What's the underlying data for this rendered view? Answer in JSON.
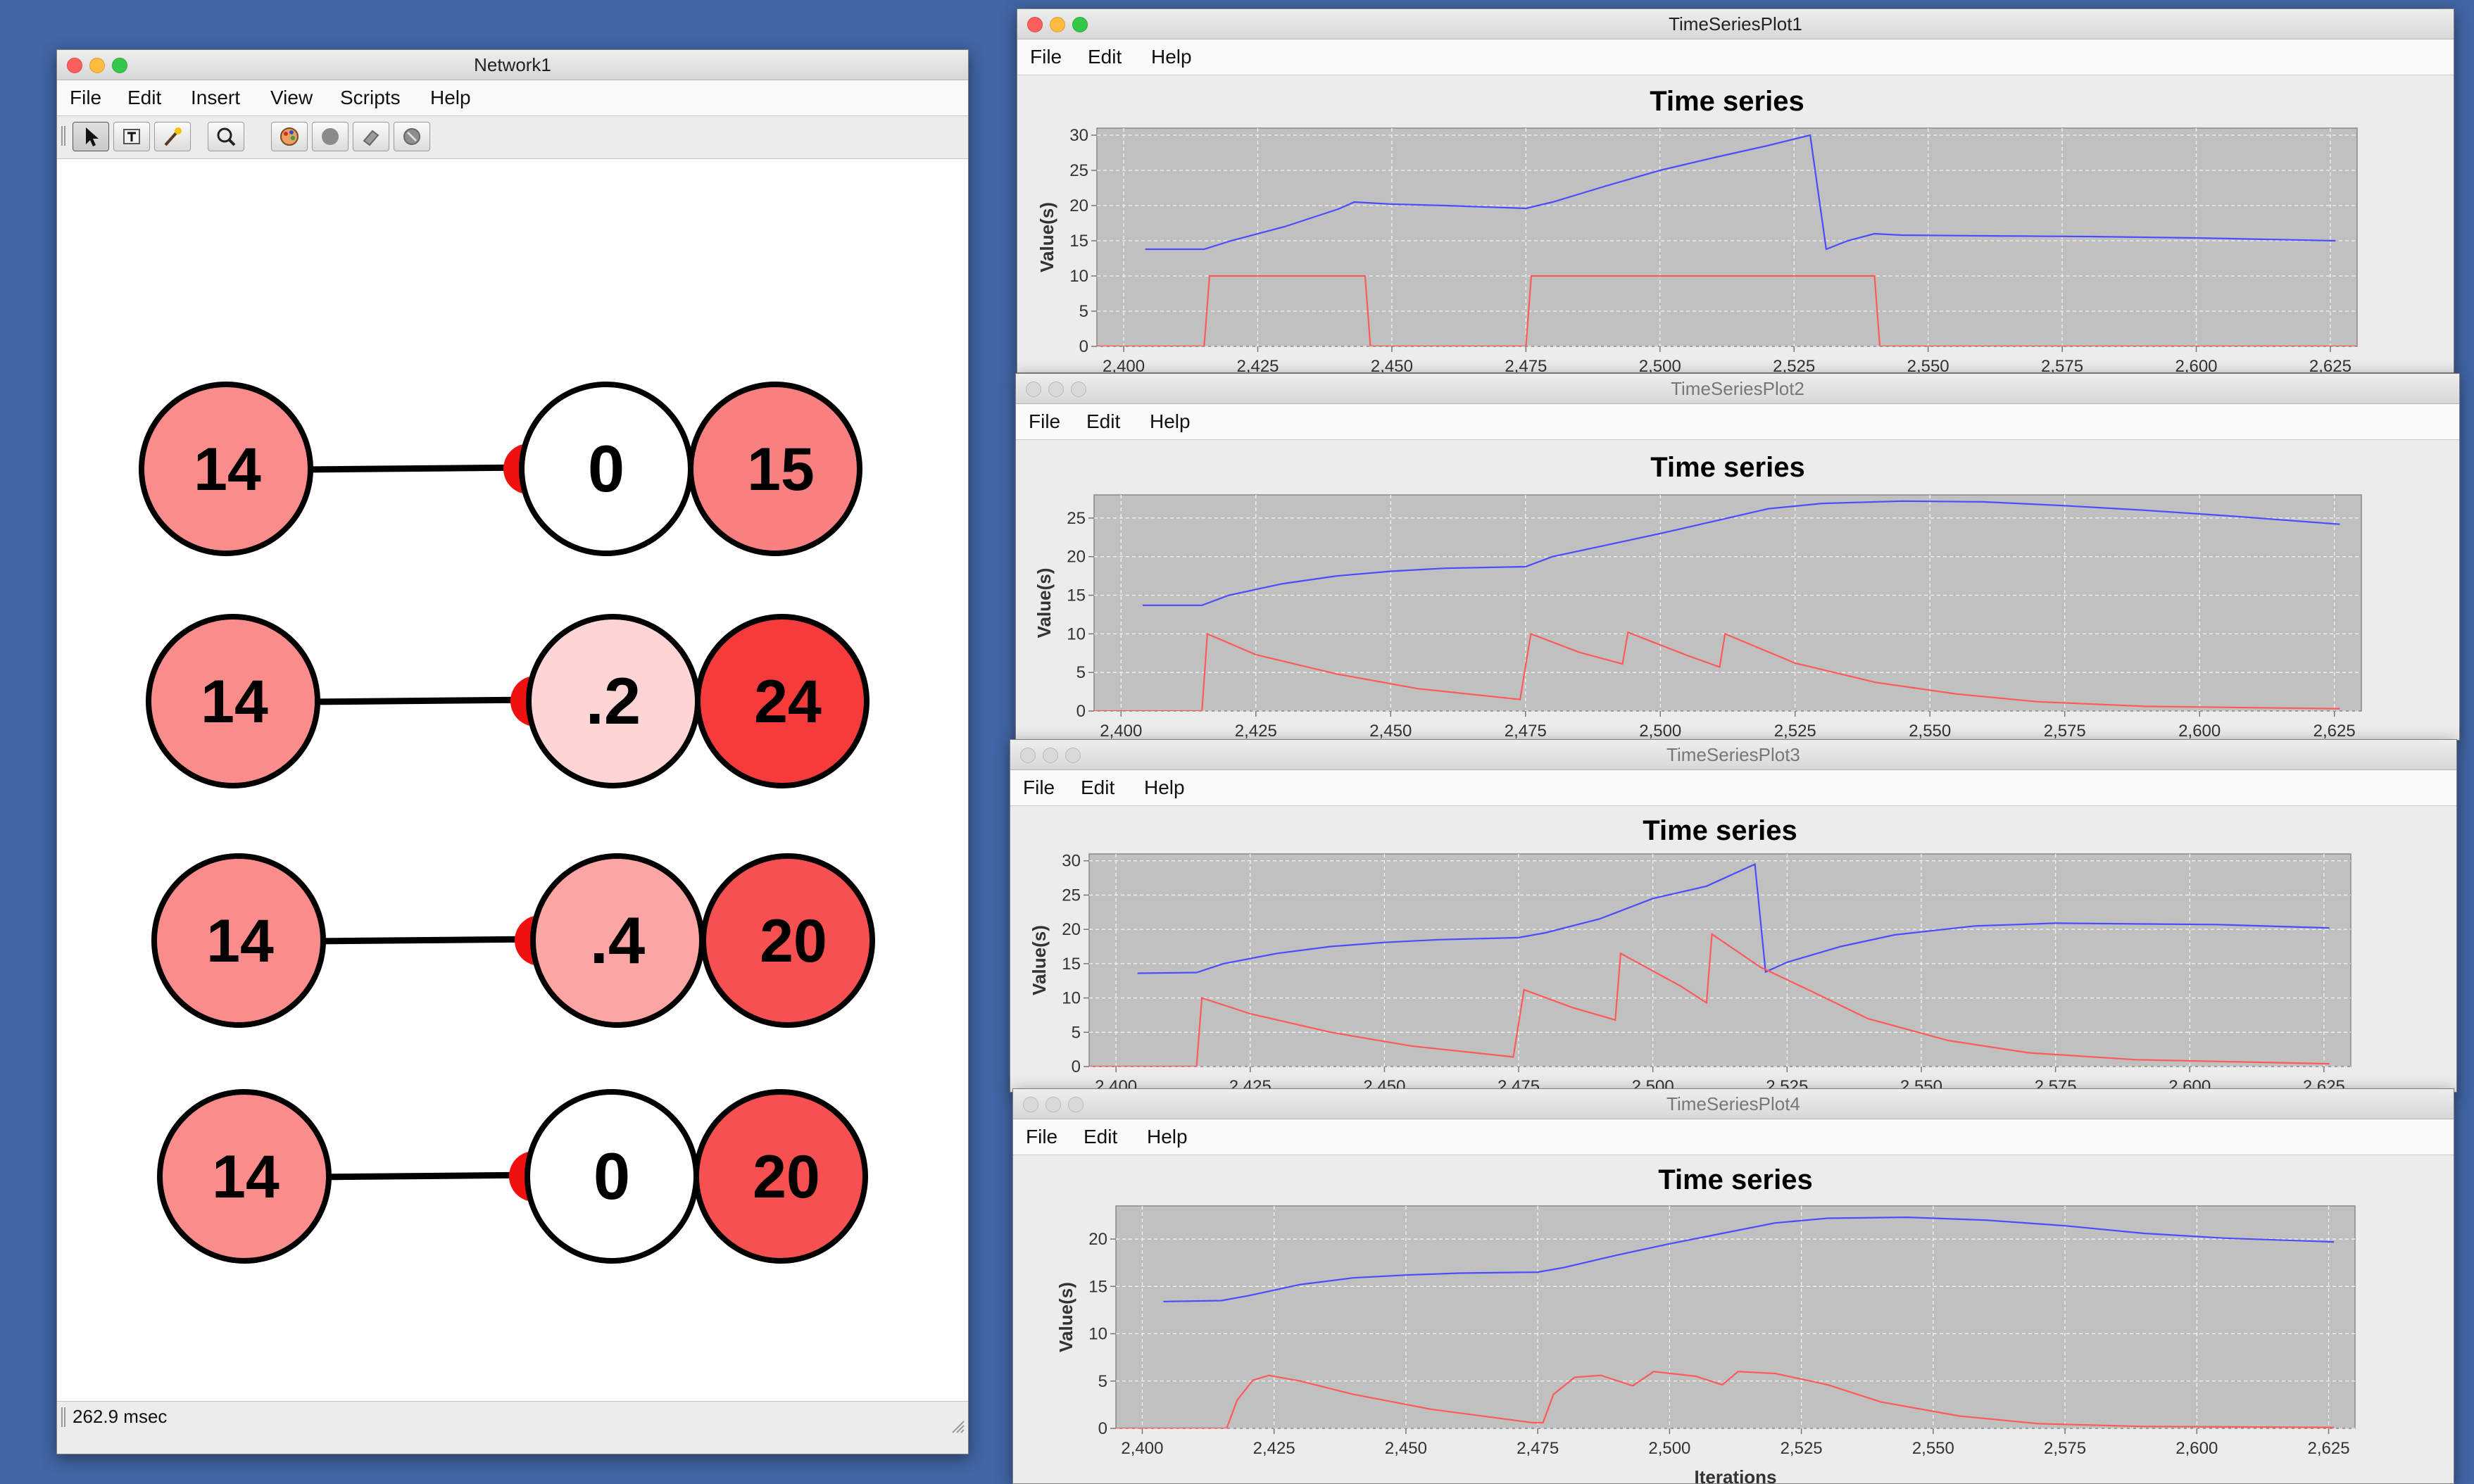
{
  "network_window": {
    "title": "Network1",
    "menu": [
      "File",
      "Edit",
      "Insert",
      "View",
      "Scripts",
      "Help"
    ],
    "tools": [
      "selection-tool-icon",
      "text-tool-icon",
      "wand-tool-icon",
      "zoom-tool-icon",
      "palette-icon",
      "gray-node-icon",
      "eraser-icon",
      "clear-icon"
    ],
    "status": "262.9 msec",
    "rows": [
      {
        "input": "14",
        "middle": "0",
        "output": "15",
        "input_color": "#fa8c8c",
        "middle_color": "#ffffff",
        "output_color": "#f98080"
      },
      {
        "input": "14",
        "middle": ".2",
        "output": "24",
        "input_color": "#fa8c8c",
        "middle_color": "#fed4d4",
        "output_color": "#f53b3b"
      },
      {
        "input": "14",
        "middle": ".4",
        "output": "20",
        "input_color": "#fa8c8c",
        "middle_color": "#fba5a5",
        "output_color": "#f65050"
      },
      {
        "input": "14",
        "middle": "0",
        "output": "20",
        "input_color": "#fa8c8c",
        "middle_color": "#ffffff",
        "output_color": "#f65050"
      }
    ]
  },
  "plot_menu": [
    "File",
    "Edit",
    "Help"
  ],
  "plots": [
    {
      "title": "TimeSeriesPlot1",
      "chart_data": {
        "type": "line",
        "title": "Time series",
        "ylabel": "Value(s)",
        "xlabel": "",
        "xlim": [
          2395,
          2630
        ],
        "ylim": [
          0,
          31
        ],
        "xticks": [
          "2,400",
          "2,425",
          "2,450",
          "2,475",
          "2,500",
          "2,525",
          "2,550",
          "2,575",
          "2,600",
          "2,625"
        ],
        "yticks": [
          "0",
          "5",
          "10",
          "15",
          "20",
          "25",
          "30"
        ],
        "grid": true,
        "series": [
          {
            "color": "#4b4bff",
            "points": [
              [
                2404,
                13.8
              ],
              [
                2415,
                13.8
              ],
              [
                2420,
                15
              ],
              [
                2430,
                17
              ],
              [
                2440,
                19.5
              ],
              [
                2443,
                20.5
              ],
              [
                2450,
                20.2
              ],
              [
                2460,
                20
              ],
              [
                2475,
                19.6
              ],
              [
                2480,
                20.5
              ],
              [
                2490,
                22.8
              ],
              [
                2500,
                25
              ],
              [
                2510,
                26.8
              ],
              [
                2520,
                28.5
              ],
              [
                2528,
                30
              ],
              [
                2531,
                13.8
              ],
              [
                2535,
                15
              ],
              [
                2540,
                16
              ],
              [
                2545,
                15.8
              ],
              [
                2560,
                15.7
              ],
              [
                2580,
                15.6
              ],
              [
                2600,
                15.4
              ],
              [
                2626,
                15
              ]
            ]
          },
          {
            "color": "#ff5a5a",
            "points": [
              [
                2395,
                0
              ],
              [
                2415,
                0
              ],
              [
                2416,
                10
              ],
              [
                2445,
                10
              ],
              [
                2446,
                0
              ],
              [
                2475,
                0
              ],
              [
                2476,
                10
              ],
              [
                2540,
                10
              ],
              [
                2541,
                0
              ],
              [
                2630,
                0
              ]
            ]
          }
        ]
      }
    },
    {
      "title": "TimeSeriesPlot2",
      "chart_data": {
        "type": "line",
        "title": "Time series",
        "ylabel": "Value(s)",
        "xlabel": "",
        "xlim": [
          2395,
          2630
        ],
        "ylim": [
          0,
          28
        ],
        "xticks": [
          "2,400",
          "2,425",
          "2,450",
          "2,475",
          "2,500",
          "2,525",
          "2,550",
          "2,575",
          "2,600",
          "2,625"
        ],
        "yticks": [
          "0",
          "5",
          "10",
          "15",
          "20",
          "25"
        ],
        "grid": true,
        "series": [
          {
            "color": "#4b4bff",
            "points": [
              [
                2404,
                13.7
              ],
              [
                2415,
                13.7
              ],
              [
                2420,
                15
              ],
              [
                2430,
                16.5
              ],
              [
                2440,
                17.5
              ],
              [
                2450,
                18.1
              ],
              [
                2460,
                18.5
              ],
              [
                2475,
                18.7
              ],
              [
                2480,
                20
              ],
              [
                2490,
                21.5
              ],
              [
                2500,
                23
              ],
              [
                2510,
                24.6
              ],
              [
                2520,
                26.2
              ],
              [
                2530,
                26.9
              ],
              [
                2545,
                27.2
              ],
              [
                2560,
                27.1
              ],
              [
                2575,
                26.6
              ],
              [
                2590,
                26
              ],
              [
                2605,
                25.3
              ],
              [
                2626,
                24.2
              ]
            ]
          },
          {
            "color": "#ff5a5a",
            "points": [
              [
                2395,
                0
              ],
              [
                2415,
                0
              ],
              [
                2416,
                10
              ],
              [
                2425,
                7.3
              ],
              [
                2440,
                4.8
              ],
              [
                2455,
                2.9
              ],
              [
                2474,
                1.5
              ],
              [
                2476,
                10
              ],
              [
                2485,
                7.6
              ],
              [
                2493,
                6.1
              ],
              [
                2494,
                10.2
              ],
              [
                2505,
                7.2
              ],
              [
                2511,
                5.7
              ],
              [
                2512,
                10
              ],
              [
                2525,
                6.2
              ],
              [
                2540,
                3.7
              ],
              [
                2555,
                2.2
              ],
              [
                2570,
                1.2
              ],
              [
                2590,
                0.6
              ],
              [
                2626,
                0.3
              ]
            ]
          }
        ]
      }
    },
    {
      "title": "TimeSeriesPlot3",
      "chart_data": {
        "type": "line",
        "title": "Time series",
        "ylabel": "Value(s)",
        "xlabel": "",
        "xlim": [
          2395,
          2630
        ],
        "ylim": [
          0,
          31
        ],
        "xticks": [
          "2,400",
          "2,425",
          "2,450",
          "2,475",
          "2,500",
          "2,525",
          "2,550",
          "2,575",
          "2,600",
          "2,625"
        ],
        "yticks": [
          "0",
          "5",
          "10",
          "15",
          "20",
          "25",
          "30"
        ],
        "grid": true,
        "series": [
          {
            "color": "#4b4bff",
            "points": [
              [
                2404,
                13.6
              ],
              [
                2415,
                13.7
              ],
              [
                2420,
                15
              ],
              [
                2430,
                16.5
              ],
              [
                2440,
                17.5
              ],
              [
                2450,
                18.1
              ],
              [
                2460,
                18.5
              ],
              [
                2475,
                18.8
              ],
              [
                2480,
                19.5
              ],
              [
                2490,
                21.5
              ],
              [
                2500,
                24.5
              ],
              [
                2510,
                26.3
              ],
              [
                2519,
                29.5
              ],
              [
                2521,
                13.8
              ],
              [
                2525,
                15.2
              ],
              [
                2535,
                17.5
              ],
              [
                2545,
                19.2
              ],
              [
                2560,
                20.5
              ],
              [
                2575,
                20.9
              ],
              [
                2590,
                20.8
              ],
              [
                2605,
                20.7
              ],
              [
                2626,
                20.2
              ]
            ]
          },
          {
            "color": "#ff5a5a",
            "points": [
              [
                2395,
                0
              ],
              [
                2415,
                0
              ],
              [
                2416,
                10
              ],
              [
                2425,
                7.7
              ],
              [
                2440,
                5
              ],
              [
                2455,
                3
              ],
              [
                2474,
                1.4
              ],
              [
                2476,
                11.2
              ],
              [
                2485,
                8.6
              ],
              [
                2493,
                6.8
              ],
              [
                2494,
                16.5
              ],
              [
                2505,
                11.8
              ],
              [
                2510,
                9.3
              ],
              [
                2511,
                19.3
              ],
              [
                2520,
                14.5
              ],
              [
                2530,
                10.8
              ],
              [
                2540,
                7
              ],
              [
                2555,
                3.8
              ],
              [
                2570,
                2
              ],
              [
                2590,
                1
              ],
              [
                2626,
                0.4
              ]
            ]
          }
        ]
      }
    },
    {
      "title": "TimeSeriesPlot4",
      "chart_data": {
        "type": "line",
        "title": "Time series",
        "ylabel": "Value(s)",
        "xlabel": "Iterations",
        "xlim": [
          2395,
          2630
        ],
        "ylim": [
          0,
          23.5
        ],
        "xticks": [
          "2,400",
          "2,425",
          "2,450",
          "2,475",
          "2,500",
          "2,525",
          "2,550",
          "2,575",
          "2,600",
          "2,625"
        ],
        "yticks": [
          "0",
          "5",
          "10",
          "15",
          "20"
        ],
        "grid": true,
        "series": [
          {
            "color": "#4b4bff",
            "points": [
              [
                2404,
                13.4
              ],
              [
                2415,
                13.5
              ],
              [
                2420,
                14
              ],
              [
                2430,
                15.2
              ],
              [
                2440,
                15.9
              ],
              [
                2450,
                16.2
              ],
              [
                2460,
                16.4
              ],
              [
                2475,
                16.5
              ],
              [
                2480,
                17
              ],
              [
                2490,
                18.3
              ],
              [
                2500,
                19.5
              ],
              [
                2510,
                20.6
              ],
              [
                2520,
                21.7
              ],
              [
                2530,
                22.2
              ],
              [
                2545,
                22.3
              ],
              [
                2560,
                22
              ],
              [
                2575,
                21.4
              ],
              [
                2590,
                20.6
              ],
              [
                2605,
                20.1
              ],
              [
                2626,
                19.7
              ]
            ]
          },
          {
            "color": "#ff5a5a",
            "points": [
              [
                2395,
                0
              ],
              [
                2416,
                0
              ],
              [
                2418,
                3
              ],
              [
                2421,
                5.1
              ],
              [
                2424,
                5.6
              ],
              [
                2430,
                5
              ],
              [
                2440,
                3.6
              ],
              [
                2455,
                2
              ],
              [
                2474,
                0.6
              ],
              [
                2476,
                0.6
              ],
              [
                2478,
                3.6
              ],
              [
                2482,
                5.4
              ],
              [
                2487,
                5.6
              ],
              [
                2493,
                4.5
              ],
              [
                2497,
                6
              ],
              [
                2505,
                5.5
              ],
              [
                2510,
                4.6
              ],
              [
                2513,
                6
              ],
              [
                2520,
                5.8
              ],
              [
                2530,
                4.6
              ],
              [
                2540,
                2.8
              ],
              [
                2555,
                1.3
              ],
              [
                2570,
                0.5
              ],
              [
                2590,
                0.2
              ],
              [
                2626,
                0.1
              ]
            ]
          }
        ]
      }
    }
  ]
}
